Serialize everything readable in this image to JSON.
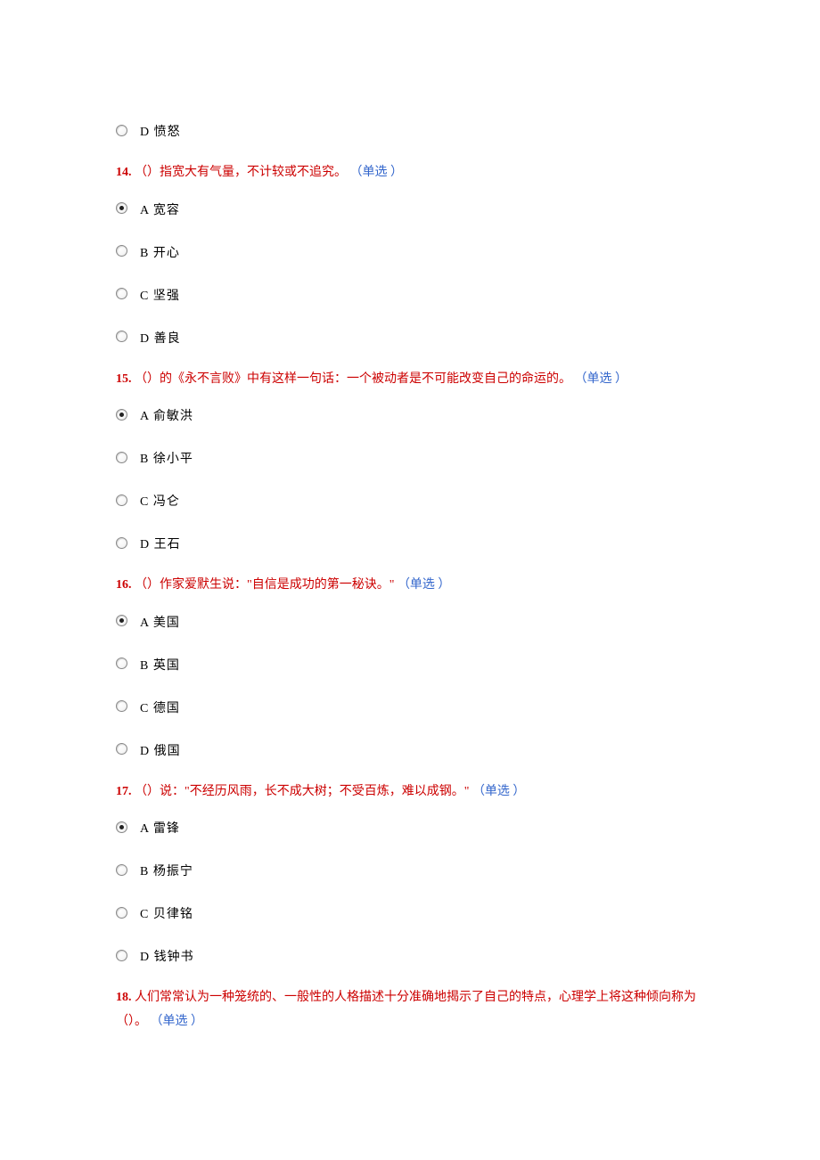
{
  "orphan_options": [
    {
      "label": "D 愤怒",
      "checked": false
    }
  ],
  "questions": [
    {
      "num": "14.",
      "stem": " （）指宽大有气量，不计较或不追究。 ",
      "tag": "（单选 ）",
      "options": [
        {
          "label": "A 宽容",
          "checked": true
        },
        {
          "label": "B 开心",
          "checked": false
        },
        {
          "label": "C 坚强",
          "checked": false
        },
        {
          "label": "D 善良",
          "checked": false
        }
      ]
    },
    {
      "num": "15.",
      "stem": " （）的《永不言败》中有这样一句话：一个被动者是不可能改变自己的命运的。 ",
      "tag": "（单选 ）",
      "options": [
        {
          "label": "A 俞敏洪",
          "checked": true
        },
        {
          "label": "B 徐小平",
          "checked": false
        },
        {
          "label": "C 冯仑",
          "checked": false
        },
        {
          "label": "D 王石",
          "checked": false
        }
      ]
    },
    {
      "num": "16.",
      "stem": " （）作家爱默生说：\"自信是成功的第一秘诀。\" ",
      "tag": "（单选 ）",
      "options": [
        {
          "label": "A 美国",
          "checked": true
        },
        {
          "label": "B 英国",
          "checked": false
        },
        {
          "label": "C 德国",
          "checked": false
        },
        {
          "label": "D 俄国",
          "checked": false
        }
      ]
    },
    {
      "num": "17.",
      "stem": " （）说：\"不经历风雨，长不成大树；不受百炼，难以成钢。\" ",
      "tag": "（单选 ）",
      "options": [
        {
          "label": "A 雷锋",
          "checked": true
        },
        {
          "label": "B 杨振宁",
          "checked": false
        },
        {
          "label": "C 贝律铭",
          "checked": false
        },
        {
          "label": "D 钱钟书",
          "checked": false
        }
      ]
    },
    {
      "num": "18.",
      "stem": " 人们常常认为一种笼统的、一般性的人格描述十分准确地揭示了自己的特点，心理学上将这种倾向称为（）。 ",
      "tag": "（单选 ）",
      "options": []
    }
  ]
}
